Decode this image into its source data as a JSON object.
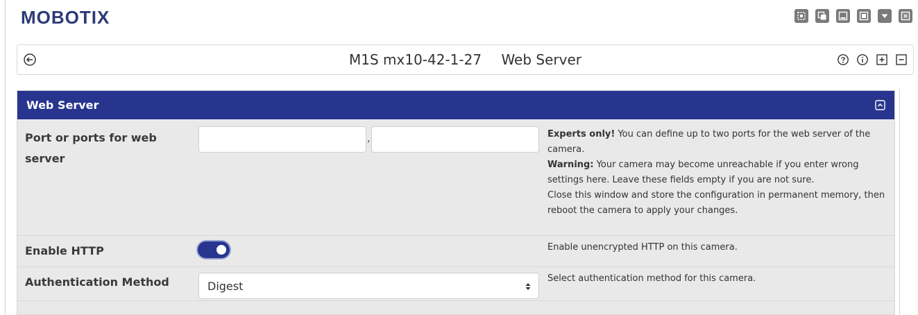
{
  "brand": {
    "logo_text": "MOBOTIX",
    "color": "#2b3a77"
  },
  "window_buttons": [
    {
      "name": "fullscreen-icon"
    },
    {
      "name": "detach-icon"
    },
    {
      "name": "minimize-icon"
    },
    {
      "name": "restore-icon"
    },
    {
      "name": "dropdown-icon"
    },
    {
      "name": "close-icon"
    }
  ],
  "titlebar": {
    "camera_name": "M1S mx10-42-1-27",
    "page_name": "Web Server",
    "icons": [
      "help-icon",
      "info-icon",
      "expand-all-icon",
      "collapse-all-icon"
    ]
  },
  "panel": {
    "title": "Web Server",
    "header_color": "#27358f",
    "rows": {
      "ports": {
        "label": "Port or ports for web server",
        "input1_value": "",
        "input2_value": "",
        "separator": ",",
        "help": {
          "experts_bold": "Experts only!",
          "experts_text": " You can define up to two ports for the web server of the camera.",
          "warning_bold": "Warning:",
          "warning_text": " Your camera may become unreachable if you enter wrong settings here. Leave these fields empty if you are not sure.",
          "close_text": "Close this window and store the configuration in permanent memory, then reboot the camera to apply your changes."
        }
      },
      "http": {
        "label": "Enable HTTP",
        "enabled": true,
        "help": "Enable unencrypted HTTP on this camera."
      },
      "auth": {
        "label": "Authentication Method",
        "selected": "Digest",
        "help": "Select authentication method for this camera."
      }
    }
  }
}
